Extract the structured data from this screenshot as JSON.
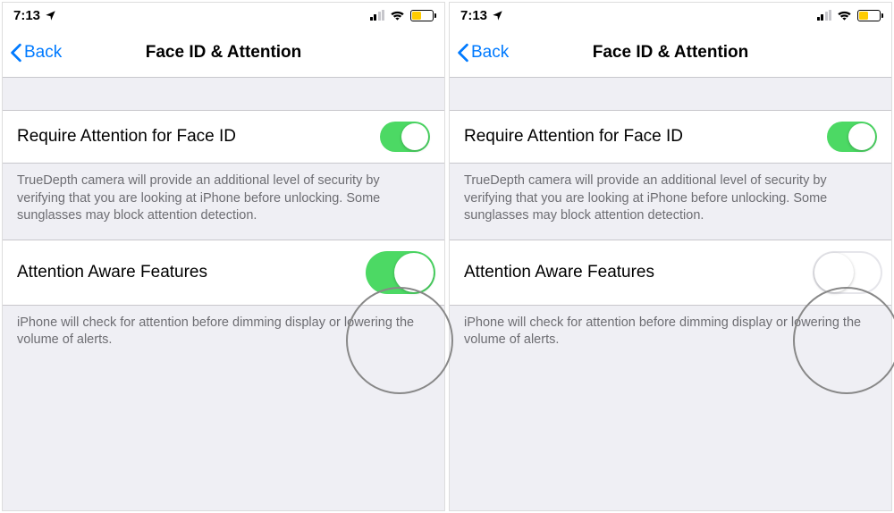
{
  "status": {
    "time": "7:13",
    "location_icon": "location-arrow"
  },
  "nav": {
    "back_label": "Back",
    "title": "Face ID & Attention"
  },
  "rows": {
    "require_attention": {
      "label": "Require Attention for Face ID",
      "footer": "TrueDepth camera will provide an additional level of security by verifying that you are looking at iPhone before unlocking. Some sunglasses may block attention detection."
    },
    "attention_aware": {
      "label": "Attention Aware Features",
      "footer": "iPhone will check for attention before dimming display or lowering the volume of alerts."
    }
  },
  "screens": [
    {
      "require_attention_on": true,
      "attention_aware_on": true
    },
    {
      "require_attention_on": true,
      "attention_aware_on": false
    }
  ]
}
